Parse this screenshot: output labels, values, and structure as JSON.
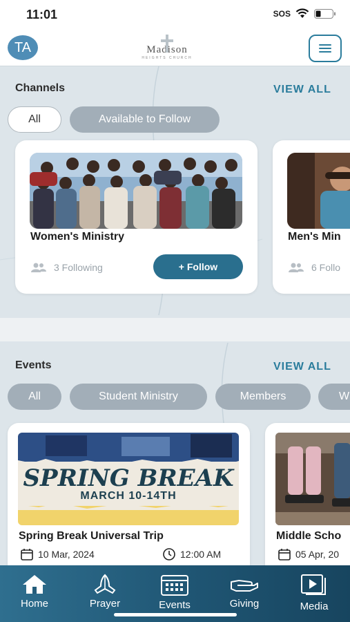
{
  "status": {
    "time": "11:01",
    "sos": "SOS"
  },
  "header": {
    "avatar_initials": "TA",
    "logo_name": "Madison",
    "logo_sub": "HEIGHTS CHURCH"
  },
  "channels": {
    "title": "Channels",
    "view_all": "VIEW ALL",
    "filters": [
      "All",
      "Available to Follow"
    ],
    "items": [
      {
        "title": "Women's Ministry",
        "following": "3 Following",
        "follow_label": "+ Follow"
      },
      {
        "title": "Men's Min",
        "following": "6 Follo"
      }
    ]
  },
  "events": {
    "title": "Events",
    "view_all": "VIEW ALL",
    "filters": [
      "All",
      "Student Ministry",
      "Members",
      "W"
    ],
    "items": [
      {
        "banner_title": "SPRING BREAK",
        "banner_dates": "MARCH 10-14TH",
        "title": "Spring Break Universal Trip",
        "date": "10 Mar, 2024",
        "time": "12:00 AM"
      },
      {
        "title": "Middle Scho",
        "date": "05 Apr, 20"
      }
    ]
  },
  "tabs": [
    {
      "label": "Home",
      "icon": "home-icon"
    },
    {
      "label": "Prayer",
      "icon": "praying-hands-icon"
    },
    {
      "label": "Events",
      "icon": "calendar-icon"
    },
    {
      "label": "Giving",
      "icon": "giving-hand-icon"
    },
    {
      "label": "Media",
      "icon": "media-play-icon"
    }
  ],
  "colors": {
    "accent": "#2a7c9c",
    "tabbar": "#1f5573",
    "chip": "#a2aeb8",
    "background": "#dde5ea"
  }
}
